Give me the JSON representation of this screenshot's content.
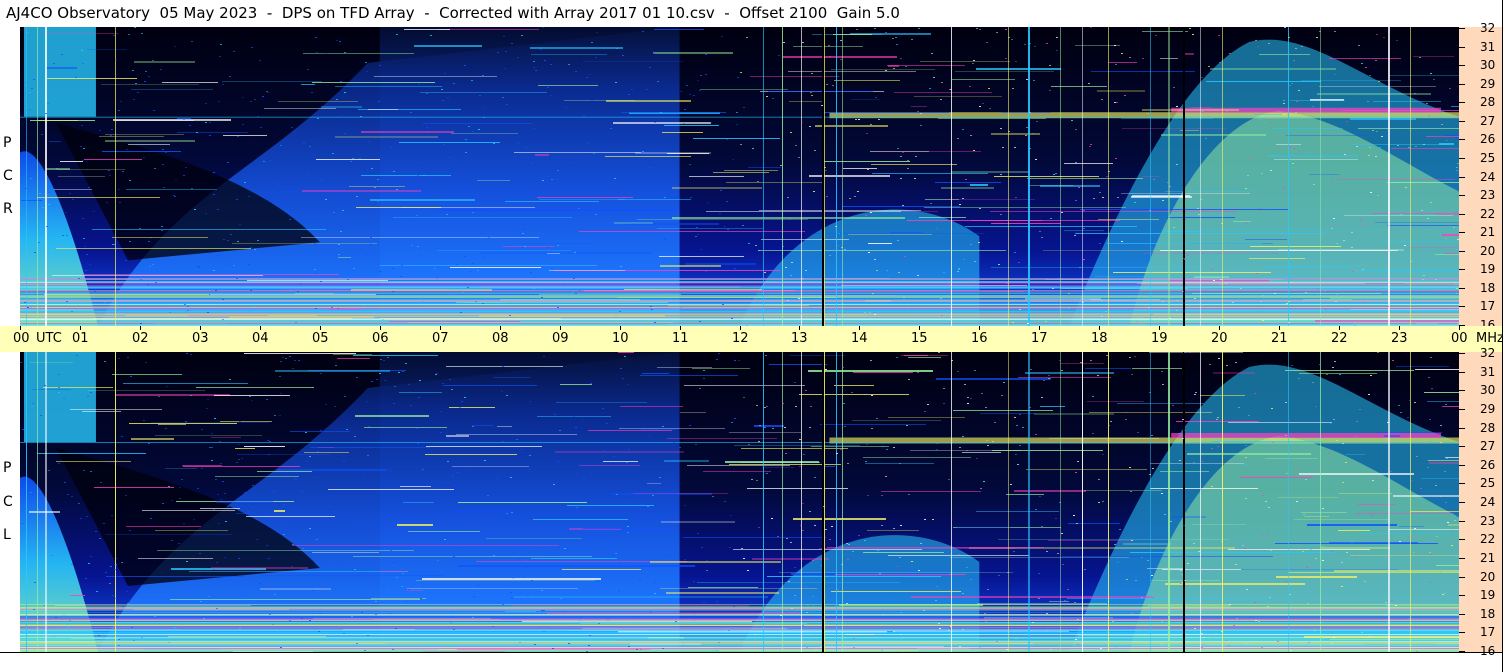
{
  "header": {
    "title": "AJ4CO Observatory  05 May 2023  -  DPS on TFD Array  -  Corrected with Array 2017 01 10.csv  -  Offset 2100  Gain 5.0"
  },
  "panels": [
    {
      "id": "rcp",
      "pol_letters": [
        "P",
        "C",
        "R"
      ]
    },
    {
      "id": "lcp",
      "pol_letters": [
        "P",
        "C",
        "L"
      ]
    }
  ],
  "freq_axis": {
    "labels": [
      "32",
      "31",
      "30",
      "29",
      "28",
      "27",
      "26",
      "25",
      "24",
      "23",
      "22",
      "21",
      "20",
      "19",
      "18",
      "17",
      "16"
    ],
    "unit": "MHz"
  },
  "time_axis": {
    "labels": [
      "00",
      "01",
      "02",
      "03",
      "04",
      "05",
      "06",
      "07",
      "08",
      "09",
      "10",
      "11",
      "12",
      "13",
      "14",
      "15",
      "16",
      "17",
      "18",
      "19",
      "20",
      "21",
      "22",
      "23",
      "00"
    ],
    "unit": "UTC"
  },
  "colors": {
    "background": "#000010",
    "dark_blue": "#0818a8",
    "mid_blue": "#1050ff",
    "cyan": "#28c8ff",
    "light_green": "#98f0a0",
    "yellow": "#f0f060",
    "magenta": "#ff40c0",
    "axis_freq": "#ffd9bc",
    "axis_time": "#ffffb8"
  }
}
